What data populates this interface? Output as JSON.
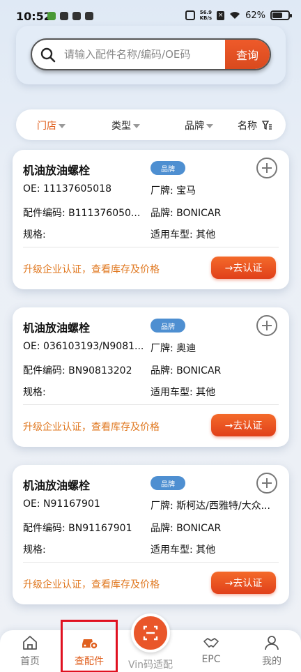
{
  "status_bar": {
    "time": "10:52",
    "net_speed_top": "56.9",
    "net_speed_bottom": "KB/s",
    "battery": "62%",
    "battery_level": 0.62
  },
  "search": {
    "placeholder": "请输入配件名称/编码/OE码",
    "button_label": "查询"
  },
  "filters": [
    {
      "label": "门店",
      "active": true
    },
    {
      "label": "类型",
      "active": false
    },
    {
      "label": "品牌",
      "active": false
    },
    {
      "label": "名称",
      "active": false
    }
  ],
  "cards": [
    {
      "title": "机油放油螺栓",
      "badge": "品牌",
      "oe": "OE: 11137605018",
      "factory_brand": "厂牌: 宝马",
      "part_code": "配件编码: B111376050...",
      "brand": "品牌: BONICAR",
      "spec": "规格:",
      "vehicle": "适用车型: 其他",
      "promo": "升级企业认证，查看库存及价格",
      "certify_label": "→去认证"
    },
    {
      "title": "机油放油螺栓",
      "badge": "品牌",
      "oe": "OE: 036103193/N9081...",
      "factory_brand": "厂牌: 奥迪",
      "part_code": "配件编码: BN90813202",
      "brand": "品牌: BONICAR",
      "spec": "规格:",
      "vehicle": "适用车型: 其他",
      "promo": "升级企业认证，查看库存及价格",
      "certify_label": "→去认证"
    },
    {
      "title": "机油放油螺栓",
      "badge": "品牌",
      "oe": "OE: N91167901",
      "factory_brand": "厂牌: 斯柯达/西雅特/大众...",
      "part_code": "配件编码: BN91167901",
      "brand": "品牌: BONICAR",
      "spec": "规格:",
      "vehicle": "适用车型: 其他",
      "promo": "升级企业认证，查看库存及价格",
      "certify_label": "→去认证"
    }
  ],
  "bottom_nav": {
    "home": "首页",
    "parts": "查配件",
    "vin": "Vin码适配",
    "epc": "EPC",
    "mine": "我的",
    "active": "parts"
  },
  "colors": {
    "accent": "#e0601f",
    "badge": "#4e8fd1",
    "highlight_box": "#e01020"
  }
}
